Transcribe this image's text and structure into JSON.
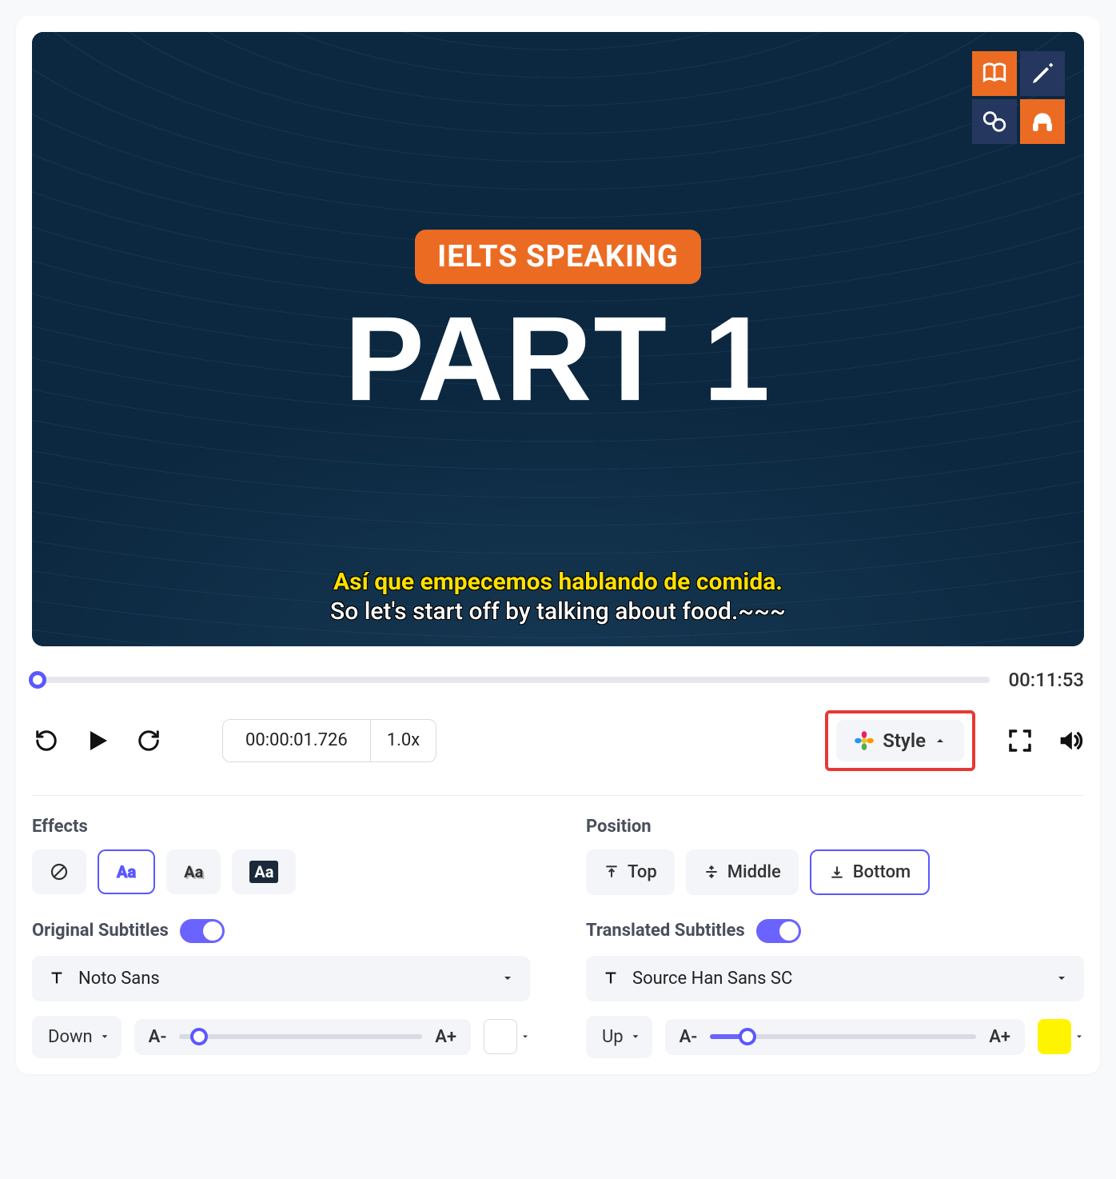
{
  "video": {
    "pill": "IELTS SPEAKING",
    "title": "PART 1",
    "subtitle_translated": "Así que empecemos hablando de comida.",
    "subtitle_original": "So let's start off by talking about food.~~~"
  },
  "player": {
    "duration": "00:11:53",
    "current_time": "00:00:01.726",
    "rate": "1.0x",
    "style_label": "Style"
  },
  "effects": {
    "heading": "Effects",
    "options": [
      "none",
      "outline",
      "shadow",
      "box"
    ]
  },
  "position": {
    "heading": "Position",
    "top": "Top",
    "middle": "Middle",
    "bottom": "Bottom"
  },
  "original": {
    "heading": "Original Subtitles",
    "font": "Noto Sans",
    "direction": "Down",
    "minus": "A-",
    "plus": "A+",
    "slider_pct": 8,
    "color": "#ffffff"
  },
  "translated": {
    "heading": "Translated Subtitles",
    "font": "Source Han Sans SC",
    "direction": "Up",
    "minus": "A-",
    "plus": "A+",
    "slider_pct": 14,
    "color": "#fff400"
  }
}
